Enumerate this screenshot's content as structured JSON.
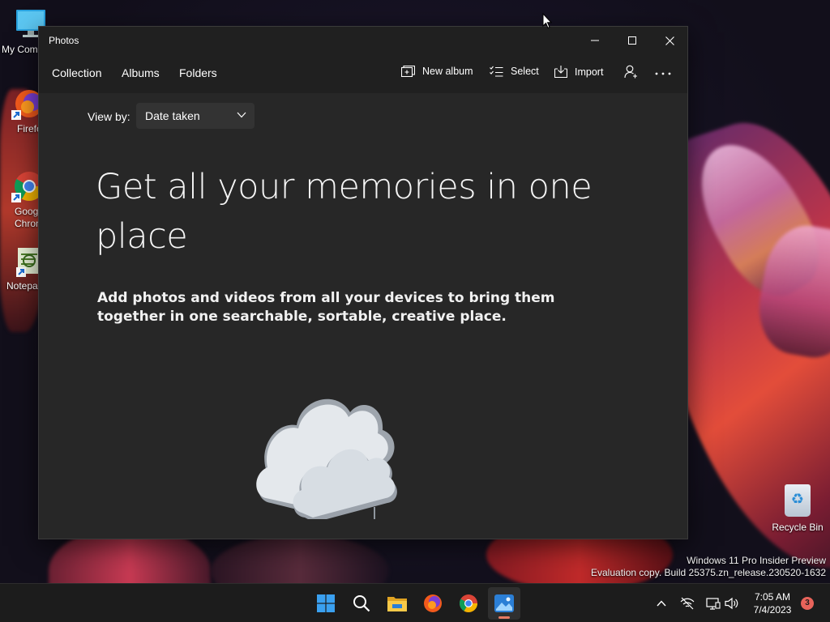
{
  "desktop": {
    "icons": [
      {
        "label": "My Com",
        "icon": "computer-icon"
      },
      {
        "label": "Firefo",
        "icon": "firefox-icon"
      },
      {
        "label": "Goog\nChron",
        "icon": "chrome-icon"
      },
      {
        "label": "Notepa",
        "icon": "notepad-icon"
      }
    ],
    "recycle_bin": {
      "label": "Recycle Bin",
      "icon": "recycle-bin-icon"
    },
    "watermark": {
      "line1": "Windows 11 Pro Insider Preview",
      "line2": "Evaluation copy. Build 25375.zn_release.230520-1632"
    }
  },
  "window": {
    "title": "Photos",
    "controls": {
      "minimize": "minimize-icon",
      "maximize": "maximize-icon",
      "close": "close-icon"
    },
    "nav": {
      "tabs": [
        {
          "label": "Collection"
        },
        {
          "label": "Albums"
        },
        {
          "label": "Folders"
        }
      ]
    },
    "toolbar": {
      "new_album": "New album",
      "select": "Select",
      "import": "Import",
      "account_icon": "person-add-icon",
      "more_icon": "more-icon"
    },
    "view_by": {
      "label": "View by:",
      "selected": "Date taken"
    },
    "empty_state": {
      "headline": "Get all your memories in one place",
      "description": "Add photos and videos from all your devices to bring them together in one searchable, sortable, creative place.",
      "illustration": "cloud-icon"
    }
  },
  "taskbar": {
    "apps": [
      {
        "name": "Start",
        "icon": "windows-start-icon"
      },
      {
        "name": "Search",
        "icon": "search-icon"
      },
      {
        "name": "File Explorer",
        "icon": "folder-icon"
      },
      {
        "name": "Firefox",
        "icon": "firefox-icon"
      },
      {
        "name": "Chrome",
        "icon": "chrome-icon"
      },
      {
        "name": "Photos",
        "icon": "photos-icon",
        "active": true
      }
    ],
    "tray": {
      "icons": [
        "chevron-up-icon",
        "network-off-icon",
        "display-icon",
        "volume-icon"
      ],
      "time": "7:05 AM",
      "date": "7/4/2023",
      "notification_count": "3"
    }
  },
  "colors": {
    "window_bg": "#272727",
    "titlebar_bg": "#202020",
    "accent": "#e87a63",
    "taskbar_bg": "#1c1c1c"
  }
}
